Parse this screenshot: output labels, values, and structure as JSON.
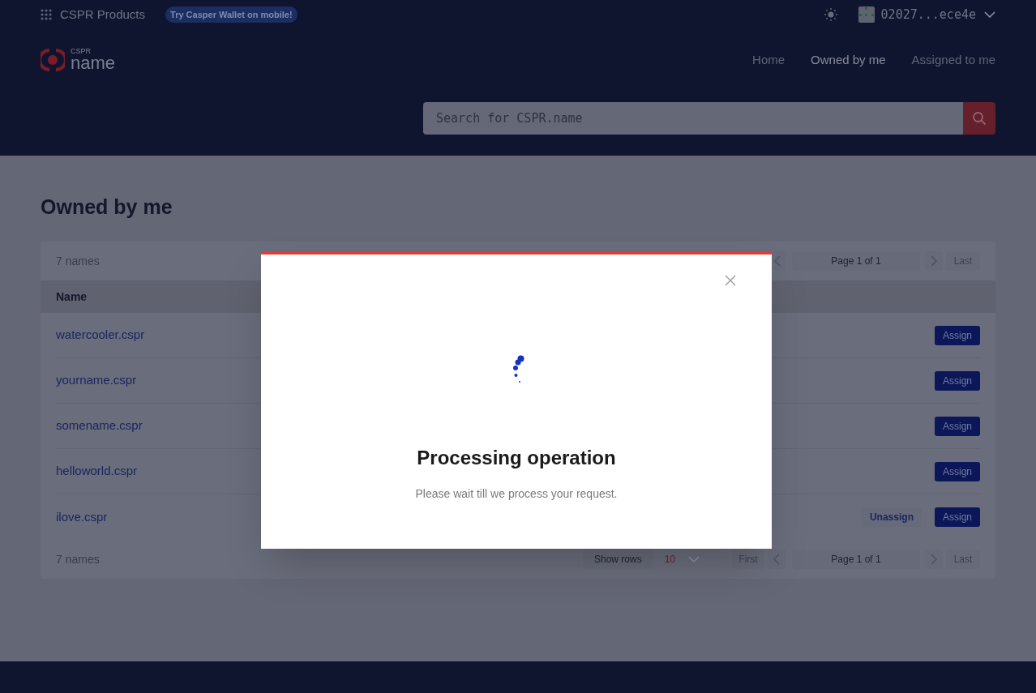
{
  "topbar": {
    "products_label": "CSPR Products",
    "promo": "Try Casper Wallet on mobile!",
    "account": "02027...ece4e"
  },
  "logo": {
    "small": "CSPR",
    "main": "name"
  },
  "nav": [
    {
      "label": "Home",
      "selected": false
    },
    {
      "label": "Owned by me",
      "selected": true
    },
    {
      "label": "Assigned to me",
      "selected": false
    }
  ],
  "search": {
    "placeholder": "Search for CSPR.name"
  },
  "page_title": "Owned by me",
  "table": {
    "count_top": "7 names",
    "pager_top": {
      "page": "Page 1 of 1",
      "last": "Last"
    },
    "columns": [
      "Name"
    ],
    "rows": [
      {
        "name": "watercooler.cspr",
        "actions": [
          "Assign"
        ]
      },
      {
        "name": "yourname.cspr",
        "actions": [
          "Assign"
        ]
      },
      {
        "name": "somename.cspr",
        "actions": [
          "Assign"
        ]
      },
      {
        "name": "helloworld.cspr",
        "actions": [
          "Assign"
        ]
      },
      {
        "name": "ilove.cspr",
        "actions": [
          "Unassign",
          "Assign"
        ]
      }
    ],
    "count_bottom": "7 names",
    "show_rows_label": "Show rows",
    "rows_value": "10",
    "pager_bottom": {
      "first": "First",
      "page": "Page 1 of 1",
      "last": "Last"
    }
  },
  "modal": {
    "title": "Processing operation",
    "message": "Please wait till we process your request."
  }
}
